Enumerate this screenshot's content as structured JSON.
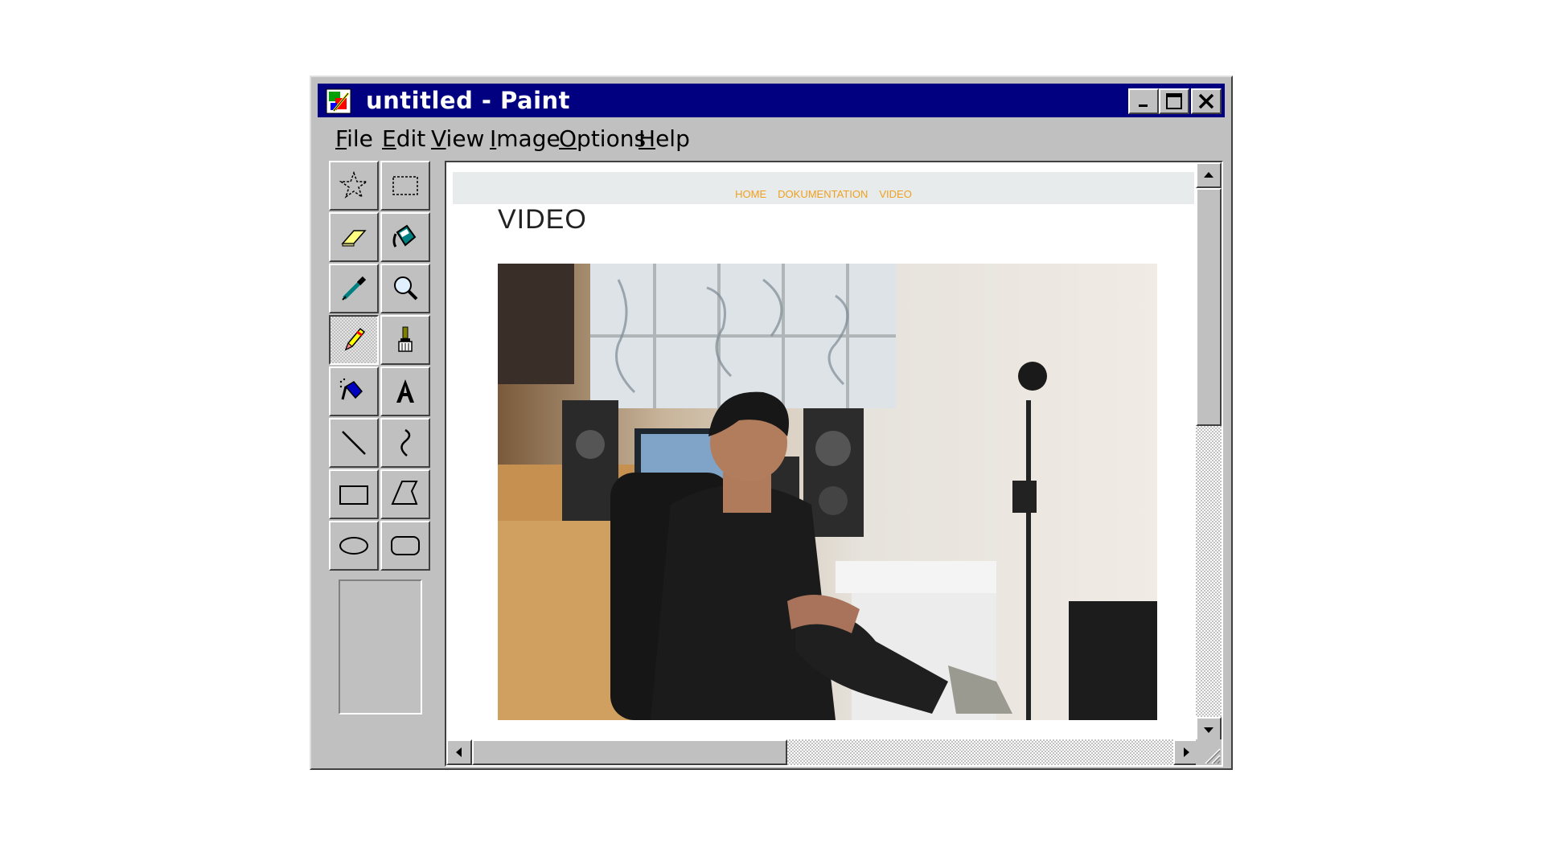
{
  "window": {
    "title": "untitled - Paint"
  },
  "title_buttons": {
    "minimize": "minimize-icon",
    "maximize": "maximize-icon",
    "close": "close-icon"
  },
  "menu": [
    {
      "first": "F",
      "rest": "ile"
    },
    {
      "first": "E",
      "rest": "dit"
    },
    {
      "first": "V",
      "rest": "iew"
    },
    {
      "first": "I",
      "rest": "mage"
    },
    {
      "first": "O",
      "rest": "ptions"
    },
    {
      "first": "H",
      "rest": "elp"
    }
  ],
  "tools": [
    "free-form-select-icon",
    "select-icon",
    "eraser-icon",
    "fill-with-color-icon",
    "pick-color-icon",
    "magnifier-icon",
    "pencil-icon",
    "brush-icon",
    "airbrush-icon",
    "text-icon",
    "line-icon",
    "curve-icon",
    "rectangle-icon",
    "polygon-icon",
    "ellipse-icon",
    "rounded-rectangle-icon"
  ],
  "active_tool": "pencil-icon",
  "canvas_page": {
    "nav": [
      "HOME",
      "DOKUMENTATION",
      "VIDEO"
    ],
    "nav_color": "#f0a020",
    "heading": "VIDEO"
  },
  "colors": {
    "title_bar": "#000080",
    "chrome": "#c0c0c0"
  }
}
